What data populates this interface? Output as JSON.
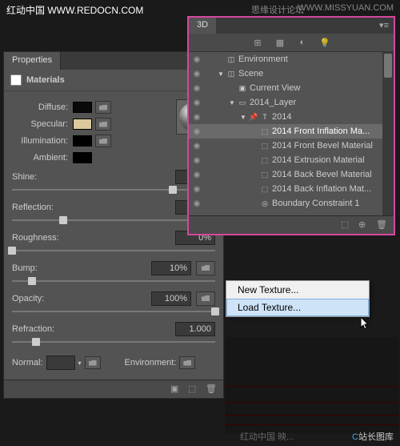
{
  "watermarks": {
    "top_left": "红动中国 WWW.REDOCN.COM",
    "top_right1": "思缘设计论坛",
    "top_right2": "WWW.MISSYUAN.COM",
    "bottom_left": "红动中国 映...",
    "bottom_right_prefix": "C",
    "bottom_right": "站长图库"
  },
  "properties": {
    "tab": "Properties",
    "header": "Materials",
    "labels": {
      "diffuse": "Diffuse:",
      "specular": "Specular:",
      "illumination": "Illumination:",
      "ambient": "Ambient:"
    },
    "sliders": {
      "shine": {
        "label": "Shine:",
        "value": "79%",
        "pos": 79
      },
      "reflection": {
        "label": "Reflection:",
        "value": "25%",
        "pos": 25
      },
      "roughness": {
        "label": "Roughness:",
        "value": "0%",
        "pos": 0
      },
      "bump": {
        "label": "Bump:",
        "value": "10%",
        "pos": 10
      },
      "opacity": {
        "label": "Opacity:",
        "value": "100%",
        "pos": 100
      },
      "refraction": {
        "label": "Refraction:",
        "value": "1.000",
        "pos": 12
      }
    },
    "normal": "Normal:",
    "environment": "Environment:"
  },
  "threed": {
    "tab": "3D",
    "items": [
      {
        "label": "Environment",
        "indent": 0,
        "icon": "◫",
        "twisty": ""
      },
      {
        "label": "Scene",
        "indent": 0,
        "icon": "◫",
        "twisty": "▼"
      },
      {
        "label": "Current View",
        "indent": 1,
        "icon": "▣",
        "twisty": ""
      },
      {
        "label": "2014_Layer",
        "indent": 1,
        "icon": "▭",
        "twisty": "▼"
      },
      {
        "label": "2014",
        "indent": 2,
        "icon": "T",
        "twisty": "▼",
        "pin": true
      },
      {
        "label": "2014 Front Inflation Ma...",
        "indent": 3,
        "icon": "⬚",
        "selected": true
      },
      {
        "label": "2014 Front Bevel Material",
        "indent": 3,
        "icon": "⬚"
      },
      {
        "label": "2014 Extrusion Material",
        "indent": 3,
        "icon": "⬚"
      },
      {
        "label": "2014 Back Bevel Material",
        "indent": 3,
        "icon": "⬚"
      },
      {
        "label": "2014 Back Inflation Mat...",
        "indent": 3,
        "icon": "⬚"
      },
      {
        "label": "Boundary Constraint 1",
        "indent": 3,
        "icon": "◎"
      }
    ]
  },
  "context_menu": {
    "new_texture": "New Texture...",
    "load_texture": "Load Texture..."
  }
}
